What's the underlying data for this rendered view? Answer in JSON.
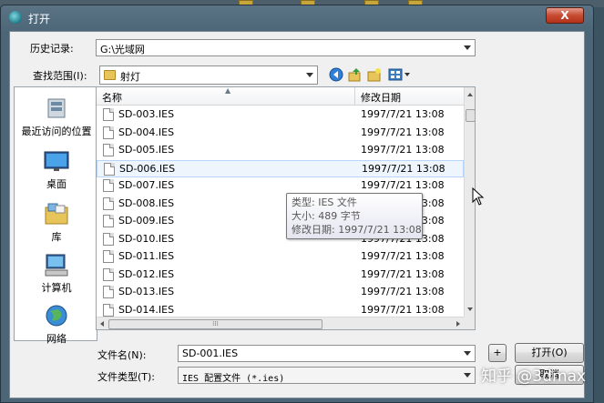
{
  "window": {
    "title": "打开",
    "close_label": "X"
  },
  "history": {
    "label": "历史记录:",
    "value": "G:\\光域网"
  },
  "look_in": {
    "label": "查找范围(I):",
    "value": "射灯"
  },
  "places": [
    {
      "label": "最近访问的位置",
      "icon": "recent-places-icon"
    },
    {
      "label": "桌面",
      "icon": "desktop-icon"
    },
    {
      "label": "库",
      "icon": "libraries-icon"
    },
    {
      "label": "计算机",
      "icon": "computer-icon"
    },
    {
      "label": "网络",
      "icon": "network-icon"
    }
  ],
  "columns": {
    "name": "名称",
    "date": "修改日期"
  },
  "files": [
    {
      "name": "SD-003.IES",
      "date": "1997/7/21 13:08"
    },
    {
      "name": "SD-004.IES",
      "date": "1997/7/21 13:08"
    },
    {
      "name": "SD-005.IES",
      "date": "1997/7/21 13:08"
    },
    {
      "name": "SD-006.IES",
      "date": "1997/7/21 13:08"
    },
    {
      "name": "SD-007.IES",
      "date": "1997/7/21 13:08"
    },
    {
      "name": "SD-008.IES",
      "date": "1997/7/21 13:08"
    },
    {
      "name": "SD-009.IES",
      "date": "1997/7/21 13:08"
    },
    {
      "name": "SD-010.IES",
      "date": "1997/7/21 13:08"
    },
    {
      "name": "SD-011.IES",
      "date": "1997/7/21 13:08"
    },
    {
      "name": "SD-012.IES",
      "date": "1997/7/21 13:08"
    },
    {
      "name": "SD-013.IES",
      "date": "1997/7/21 13:08"
    },
    {
      "name": "SD-014.IES",
      "date": "1997/7/21 13:08"
    }
  ],
  "hovered_index": 3,
  "tooltip": {
    "type": "类型: IES 文件",
    "size": "大小: 489 字节",
    "modified": "修改日期: 1997/7/21 13:08"
  },
  "filename": {
    "label": "文件名(N):",
    "value": "SD-001.IES"
  },
  "filetype": {
    "label": "文件类型(T):",
    "value": "IES 配置文件 (*.ies)"
  },
  "buttons": {
    "plus": "+",
    "open": "打开(O)",
    "cancel": "取消"
  },
  "watermark": "知乎 @3dmax",
  "colors": {
    "hover_bg": "#eef5fd",
    "hover_border": "#b8d6fb",
    "frame": "#4c6678"
  }
}
